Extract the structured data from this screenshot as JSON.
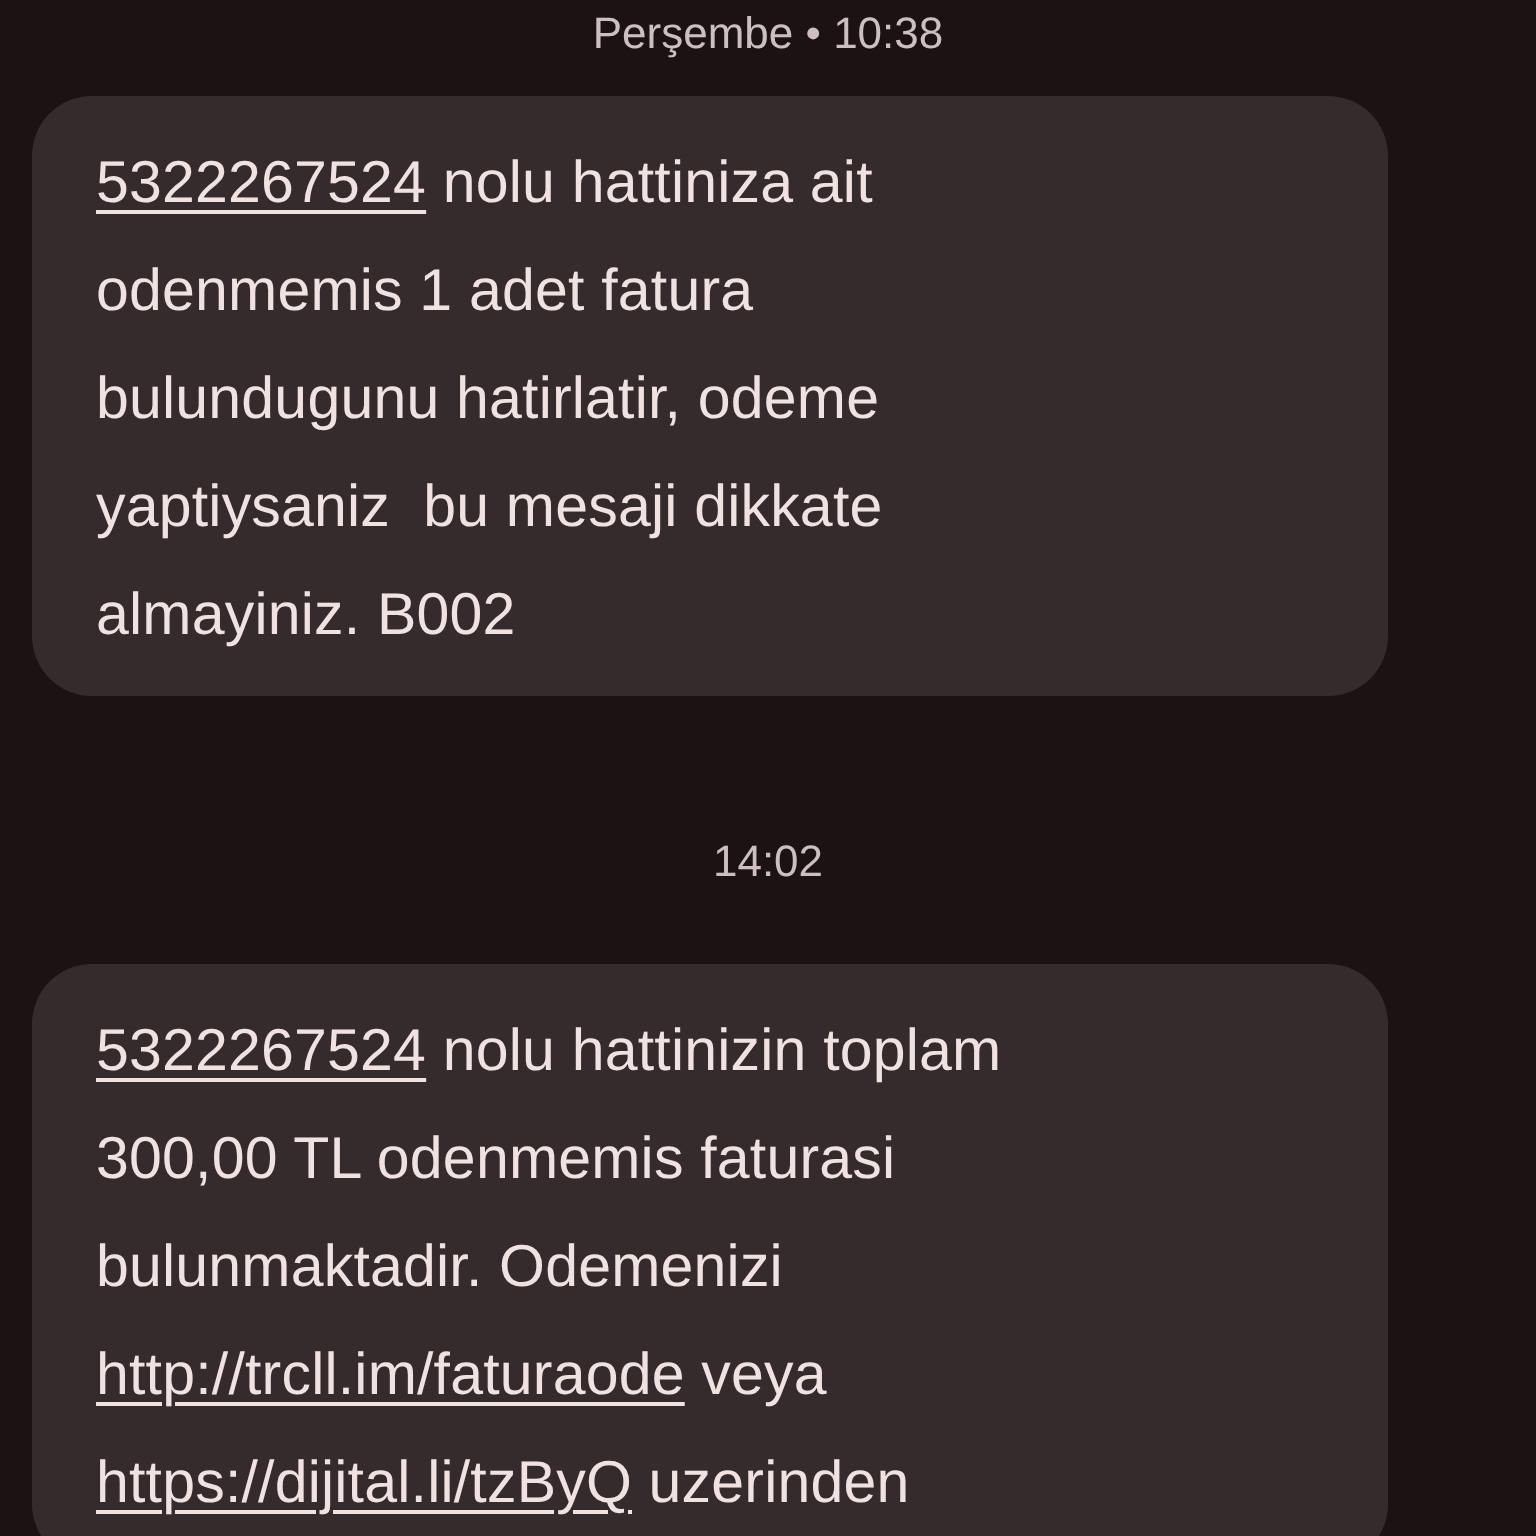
{
  "conversation": [
    {
      "kind": "timestamp",
      "text": "Perşembe • 10:38"
    },
    {
      "kind": "message",
      "lines": [
        [
          {
            "kind": "link",
            "text": "5322267524"
          },
          {
            "kind": "text",
            "text": " nolu hattiniza ait"
          }
        ],
        [
          {
            "kind": "text",
            "text": "odenmemis 1 adet fatura"
          }
        ],
        [
          {
            "kind": "text",
            "text": "bulundugunu hatirlatir, odeme"
          }
        ],
        [
          {
            "kind": "text",
            "text": "yaptiysaniz  bu mesaji dikkate"
          }
        ],
        [
          {
            "kind": "text",
            "text": "almayiniz. B002"
          }
        ]
      ]
    },
    {
      "kind": "timestamp",
      "text": "14:02"
    },
    {
      "kind": "message",
      "lines": [
        [
          {
            "kind": "link",
            "text": "5322267524"
          },
          {
            "kind": "text",
            "text": " nolu hattinizin toplam"
          }
        ],
        [
          {
            "kind": "text",
            "text": "300,00 TL odenmemis faturasi"
          }
        ],
        [
          {
            "kind": "text",
            "text": "bulunmaktadir. Odemenizi"
          }
        ],
        [
          {
            "kind": "link",
            "text": "http://trcll.im/faturaode"
          },
          {
            "kind": "text",
            "text": " veya"
          }
        ],
        [
          {
            "kind": "link",
            "text": "https://dijital.li/tzByQ"
          },
          {
            "kind": "text",
            "text": " uzerinden"
          }
        ]
      ]
    }
  ]
}
